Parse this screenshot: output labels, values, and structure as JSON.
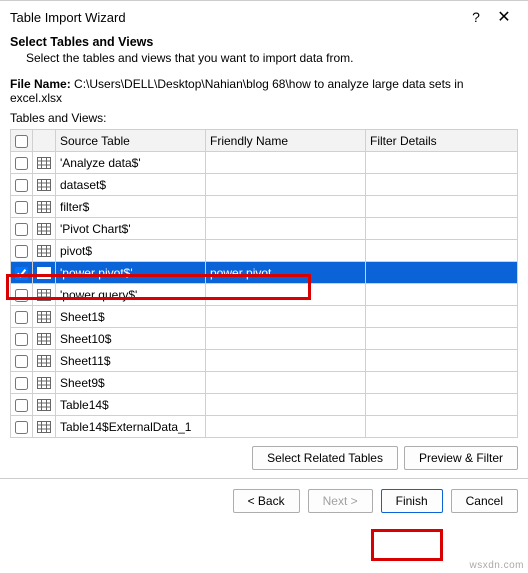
{
  "window": {
    "title": "Table Import Wizard",
    "help": "?",
    "close": "✕"
  },
  "header": {
    "title": "Select Tables and Views",
    "desc": "Select the tables and views that you want to import data from."
  },
  "file": {
    "label": "File Name:",
    "path": "C:\\Users\\DELL\\Desktop\\Nahian\\blog 68\\how to analyze large data sets in excel.xlsx"
  },
  "tables_label": "Tables and Views:",
  "columns": {
    "source": "Source Table",
    "friendly": "Friendly Name",
    "filter": "Filter Details"
  },
  "rows": [
    {
      "checked": false,
      "source": "'Analyze data$'",
      "friendly": "",
      "selected": false
    },
    {
      "checked": false,
      "source": "dataset$",
      "friendly": "",
      "selected": false
    },
    {
      "checked": false,
      "source": "filter$",
      "friendly": "",
      "selected": false
    },
    {
      "checked": false,
      "source": "'Pivot Chart$'",
      "friendly": "",
      "selected": false
    },
    {
      "checked": false,
      "source": "pivot$",
      "friendly": "",
      "selected": false
    },
    {
      "checked": true,
      "source": "'power pivot$'",
      "friendly": "power pivot",
      "selected": true
    },
    {
      "checked": false,
      "source": "'power query$'",
      "friendly": "",
      "selected": false
    },
    {
      "checked": false,
      "source": "Sheet1$",
      "friendly": "",
      "selected": false
    },
    {
      "checked": false,
      "source": "Sheet10$",
      "friendly": "",
      "selected": false
    },
    {
      "checked": false,
      "source": "Sheet11$",
      "friendly": "",
      "selected": false
    },
    {
      "checked": false,
      "source": "Sheet9$",
      "friendly": "",
      "selected": false
    },
    {
      "checked": false,
      "source": "Table14$",
      "friendly": "",
      "selected": false
    },
    {
      "checked": false,
      "source": "Table14$ExternalData_1",
      "friendly": "",
      "selected": false
    }
  ],
  "buttons": {
    "select_related": "Select Related Tables",
    "preview": "Preview & Filter",
    "back": "< Back",
    "next": "Next >",
    "finish": "Finish",
    "cancel": "Cancel"
  },
  "watermark": "wsxdn.com"
}
